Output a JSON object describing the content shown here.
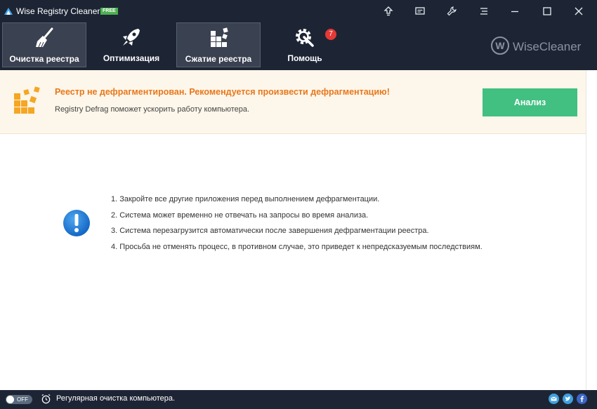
{
  "window": {
    "title": "Wise Registry Cleaner 9",
    "edition_badge": "FREE"
  },
  "titlebar_buttons": [
    {
      "name": "upgrade",
      "icon": "arrow-up-icon"
    },
    {
      "name": "feedback",
      "icon": "message-icon"
    },
    {
      "name": "skin",
      "icon": "wrench-icon"
    },
    {
      "name": "menu",
      "icon": "menu-icon"
    },
    {
      "name": "minimize",
      "icon": "minimize-icon"
    },
    {
      "name": "maximize",
      "icon": "maximize-icon"
    },
    {
      "name": "close",
      "icon": "close-icon"
    }
  ],
  "nav": {
    "tabs": [
      {
        "label": "Очистка реестра",
        "icon": "broom-icon",
        "active": true
      },
      {
        "label": "Оптимизация",
        "icon": "rocket-icon",
        "active": false
      },
      {
        "label": "Сжатие реестра",
        "icon": "blocks-icon",
        "active": true
      },
      {
        "label": "Помощь",
        "icon": "gear-wrench-icon",
        "active": false,
        "badge": "7"
      }
    ]
  },
  "brand": {
    "logo_letter": "W",
    "name": "WiseCleaner"
  },
  "banner": {
    "title": "Реестр не дефрагментирован. Рекомендуется произвести дефрагментацию!",
    "subtitle": "Registry Defrag поможет ускорить работу компьютера.",
    "button_label": "Анализ"
  },
  "notes": [
    "1. Закройте все другие приложения перед выполнением дефрагментации.",
    "2. Система может временно не отвечать на запросы во время анализа.",
    "3. Система перезагрузится автоматически после завершения дефрагментации реестра.",
    "4. Просьба не отменять процесс, в противном случае, это приведет к непредсказуемым последствиям."
  ],
  "status": {
    "toggle_label": "OFF",
    "schedule_text": "Регулярная очистка компьютера."
  },
  "colors": {
    "titlebar_bg": "#1d2535",
    "accent_orange": "#e8771a",
    "accent_green": "#42c082",
    "badge_red": "#e53935"
  }
}
